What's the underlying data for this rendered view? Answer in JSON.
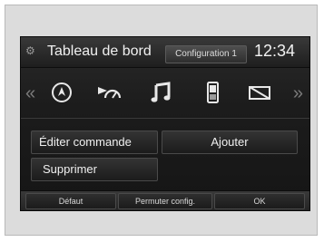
{
  "header": {
    "title": "Tableau de bord",
    "config_tab": "Configuration 1",
    "clock": "12:34",
    "icon": "gear-icon"
  },
  "icons": [
    {
      "name": "navigation-compass-icon"
    },
    {
      "name": "speedometer-icon"
    },
    {
      "name": "music-note-icon"
    },
    {
      "name": "phone-icon"
    },
    {
      "name": "message-icon"
    }
  ],
  "navigation": {
    "left_arrow": "«",
    "right_arrow": "»"
  },
  "buttons": {
    "edit_command": "Éditer commande",
    "add": "Ajouter",
    "delete": "Supprimer"
  },
  "footer": {
    "default": "Défaut",
    "swap_config": "Permuter config.",
    "ok": "OK"
  },
  "colors": {
    "screen_bg": "#1c1c1c",
    "text": "#f0f0f0",
    "frame_bg": "#dcdcdc"
  }
}
